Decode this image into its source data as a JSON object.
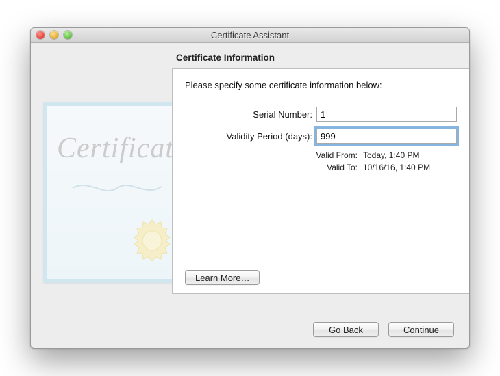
{
  "window": {
    "title": "Certificate Assistant"
  },
  "page": {
    "heading": "Certificate Information",
    "instruction": "Please specify some certificate information below:"
  },
  "form": {
    "serial": {
      "label": "Serial Number:",
      "value": "1"
    },
    "validity": {
      "label": "Validity Period (days):",
      "value": "999"
    },
    "valid_from": {
      "label": "Valid From:",
      "value": "Today, 1:40 PM"
    },
    "valid_to": {
      "label": "Valid To:",
      "value": "10/16/16, 1:40 PM"
    }
  },
  "buttons": {
    "learn_more": "Learn More…",
    "go_back": "Go Back",
    "continue": "Continue"
  },
  "graphic": {
    "script_text": "Certificate"
  }
}
